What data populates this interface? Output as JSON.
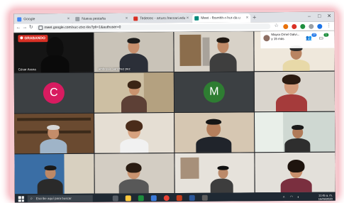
{
  "browser": {
    "tabs": [
      {
        "label": "Google",
        "favicon_color": "#4285f4"
      },
      {
        "label": "Nueva pestaña",
        "favicon_color": "#9aa0a6"
      },
      {
        "label": "Tedetrec - arturo.fraccari.edu",
        "favicon_color": "#d93025"
      },
      {
        "label": "Meet - fbsmhh-r-hur-da u",
        "favicon_color": "#00897b"
      }
    ],
    "new_tab_symbol": "+",
    "window_controls": [
      "–",
      "□",
      "✕"
    ],
    "url": "meet.google.com/xuc-ztxc-tkv?pli=1&authuser=0"
  },
  "meet": {
    "recording_label": "GRABANDO",
    "host_name": "Mayra Ornel Galvi...",
    "host_sub": "y 15 más",
    "participant_count": "20",
    "chat_badge": "1",
    "tiles": [
      {
        "name": "César Arana"
      },
      {
        "name": "ambrosio sanchez pez"
      },
      {
        "name": ""
      },
      {
        "name": ""
      },
      {
        "name": "",
        "avatar_letter": "C",
        "avatar_color": "#d81b60"
      },
      {
        "name": ""
      },
      {
        "name": "",
        "avatar_letter": "M",
        "avatar_color": "#2e7d32"
      },
      {
        "name": ""
      },
      {
        "name": ""
      },
      {
        "name": ""
      },
      {
        "name": ""
      },
      {
        "name": ""
      },
      {
        "name": ""
      },
      {
        "name": ""
      },
      {
        "name": ""
      },
      {
        "name": ""
      }
    ]
  },
  "taskbar": {
    "search_placeholder": "Escribe aquí para buscar",
    "time": "11:45 a. m.",
    "date": "15/09/2020"
  }
}
